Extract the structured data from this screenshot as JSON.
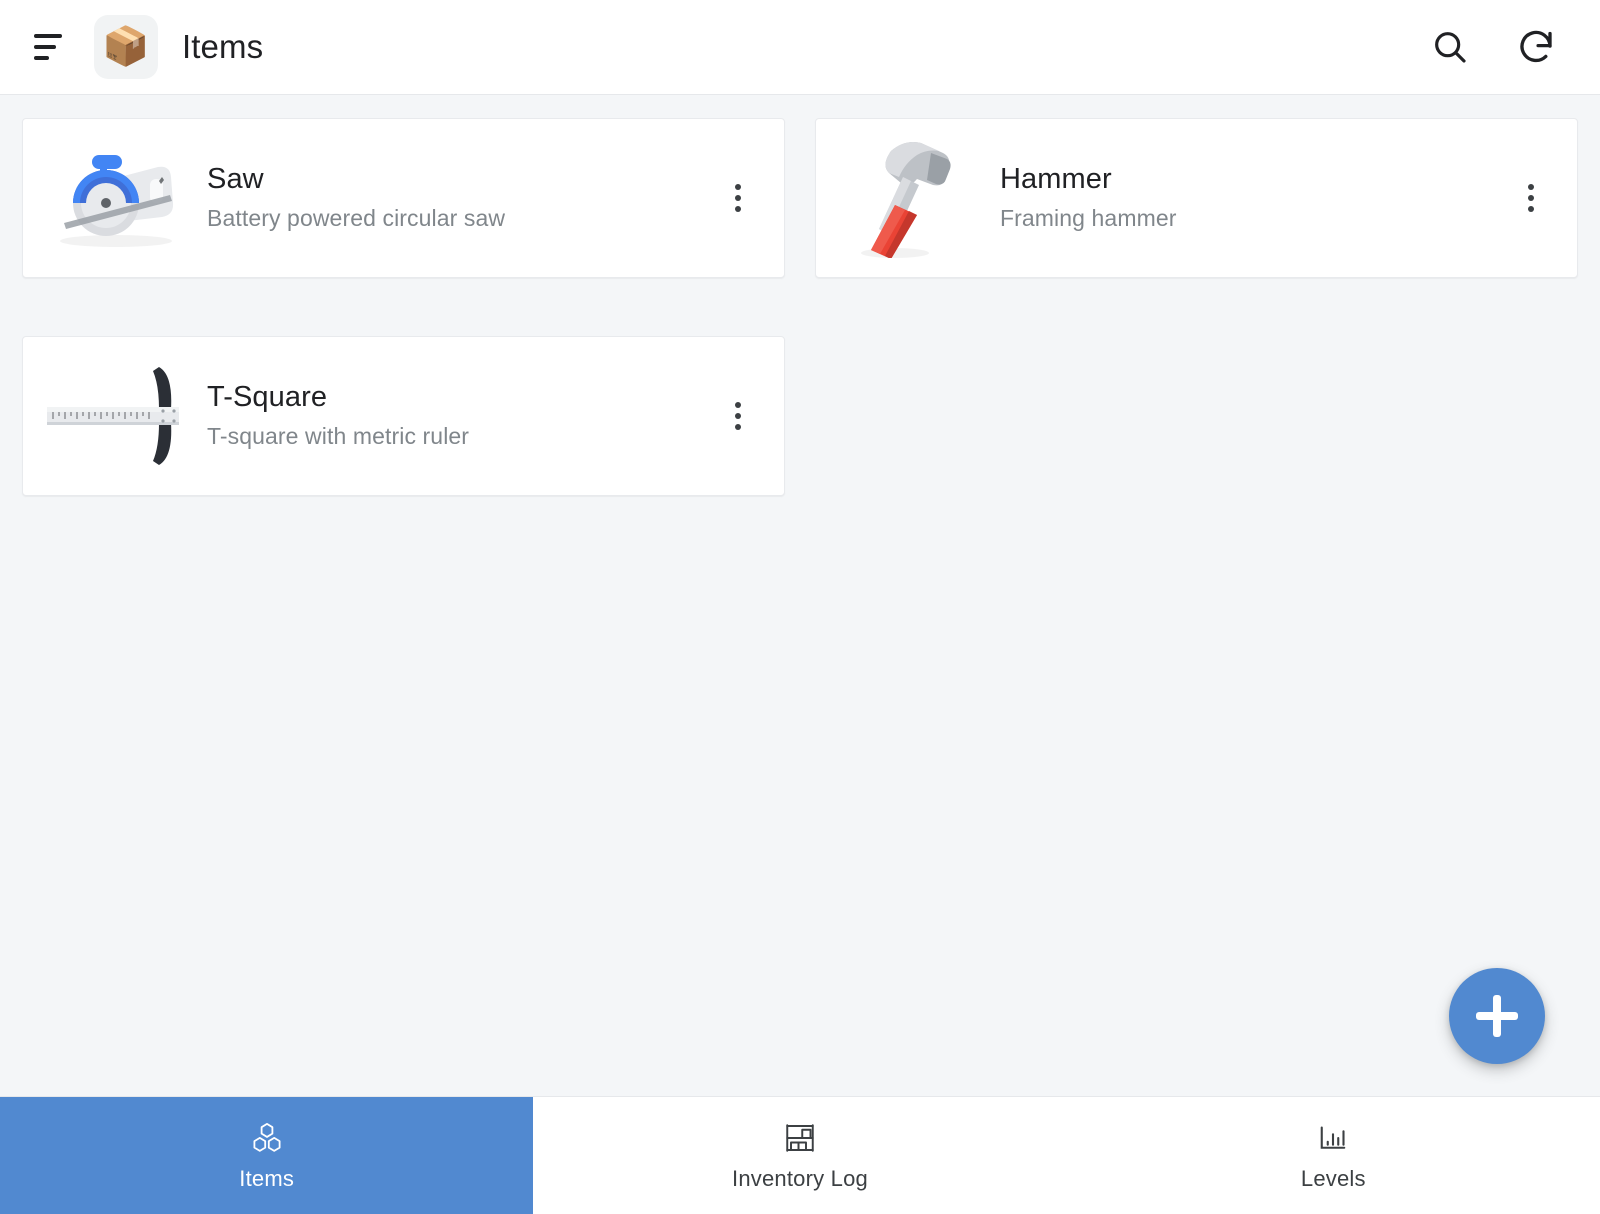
{
  "appbar": {
    "menu_icon": "sort-menu-icon",
    "app_icon_emoji": "📦",
    "title": "Items",
    "actions": [
      {
        "name": "search-icon",
        "label": "Search"
      },
      {
        "name": "refresh-icon",
        "label": "Refresh"
      }
    ]
  },
  "items": [
    {
      "title": "Saw",
      "subtitle": "Battery powered circular saw",
      "thumb": "circular-saw-illustration",
      "menu_icon": "more-vertical-icon"
    },
    {
      "title": "Hammer",
      "subtitle": "Framing hammer",
      "thumb": "hammer-illustration",
      "menu_icon": "more-vertical-icon"
    },
    {
      "title": "T-Square",
      "subtitle": "T-square with metric ruler",
      "thumb": "t-square-illustration",
      "menu_icon": "more-vertical-icon"
    }
  ],
  "fab": {
    "icon": "plus-icon",
    "label": "Add item"
  },
  "bottom_nav": {
    "active_index": 0,
    "tabs": [
      {
        "label": "Items",
        "icon": "cubes-icon"
      },
      {
        "label": "Inventory Log",
        "icon": "shelf-icon"
      },
      {
        "label": "Levels",
        "icon": "bar-chart-icon"
      }
    ]
  },
  "colors": {
    "accent": "#5189d0",
    "page_background": "#f4f6f8",
    "card_background": "#ffffff",
    "card_border": "#e8eaed",
    "title_text": "#202124",
    "subtitle_text": "#80868b"
  }
}
